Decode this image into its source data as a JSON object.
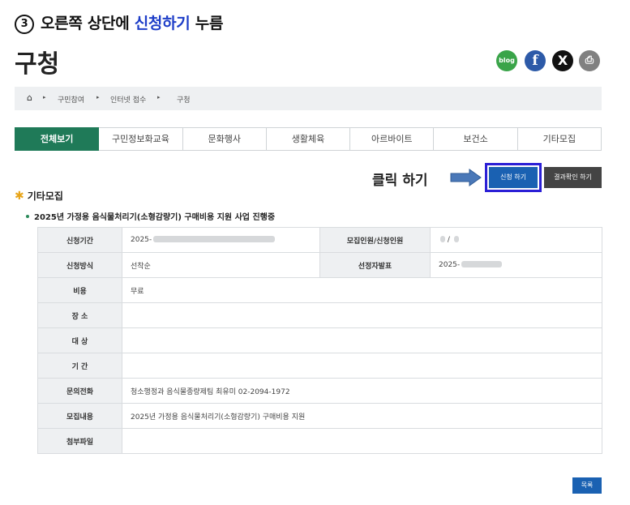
{
  "instruction": {
    "number": "3",
    "before": "오른쪽 상단에 ",
    "highlight": "신청하기",
    "after": " 누름"
  },
  "page": {
    "title": "구청"
  },
  "sns": {
    "blog": "blog",
    "facebook": "f",
    "x": "X",
    "print": "⎙"
  },
  "breadcrumb": {
    "home": "⌂",
    "separator": "▸",
    "items": [
      "구민참여",
      "인터넷 접수",
      "구청"
    ]
  },
  "tabs": [
    "전체보기",
    "구민정보화교육",
    "문화행사",
    "생활체육",
    "아르바이트",
    "보건소",
    "기타모집"
  ],
  "active_tab": "전체보기",
  "annotation": {
    "click_label": "클릭 하기"
  },
  "buttons": {
    "apply": "신청 하기",
    "result": "결과확인 하기",
    "list": "목록"
  },
  "section": {
    "title": "기타모집",
    "subtitle": "2025년 가정용 음식물처리기(소형감량기) 구매비용 지원 사업 진행중"
  },
  "table": {
    "period_label": "신청기간",
    "period_value": "2025-",
    "capacity_label": "모집인원/신청인원",
    "capacity_value": "/",
    "method_label": "신청방식",
    "method_value": "선착순",
    "announce_label": "선정자발표",
    "announce_value": "2025-",
    "fee_label": "비용",
    "fee_value": "무료",
    "place_label": "장 소",
    "place_value": "",
    "target_label": "대 상",
    "target_value": "",
    "duration_label": "기 간",
    "duration_value": "",
    "contact_label": "문의전화",
    "contact_value": "청소행정과 음식물종량제팀 최유미 02-2094-1972",
    "content_label": "모집내용",
    "content_value": "2025년 가정용 음식물처리기(소형감량기) 구매비용 지원",
    "attach_label": "첨부파일",
    "attach_value": ""
  },
  "colors": {
    "tab_active": "#1f7a58",
    "button_blue": "#1a61b2",
    "highlight_box": "#2b1fd6",
    "arrow": "#4a78b8"
  }
}
